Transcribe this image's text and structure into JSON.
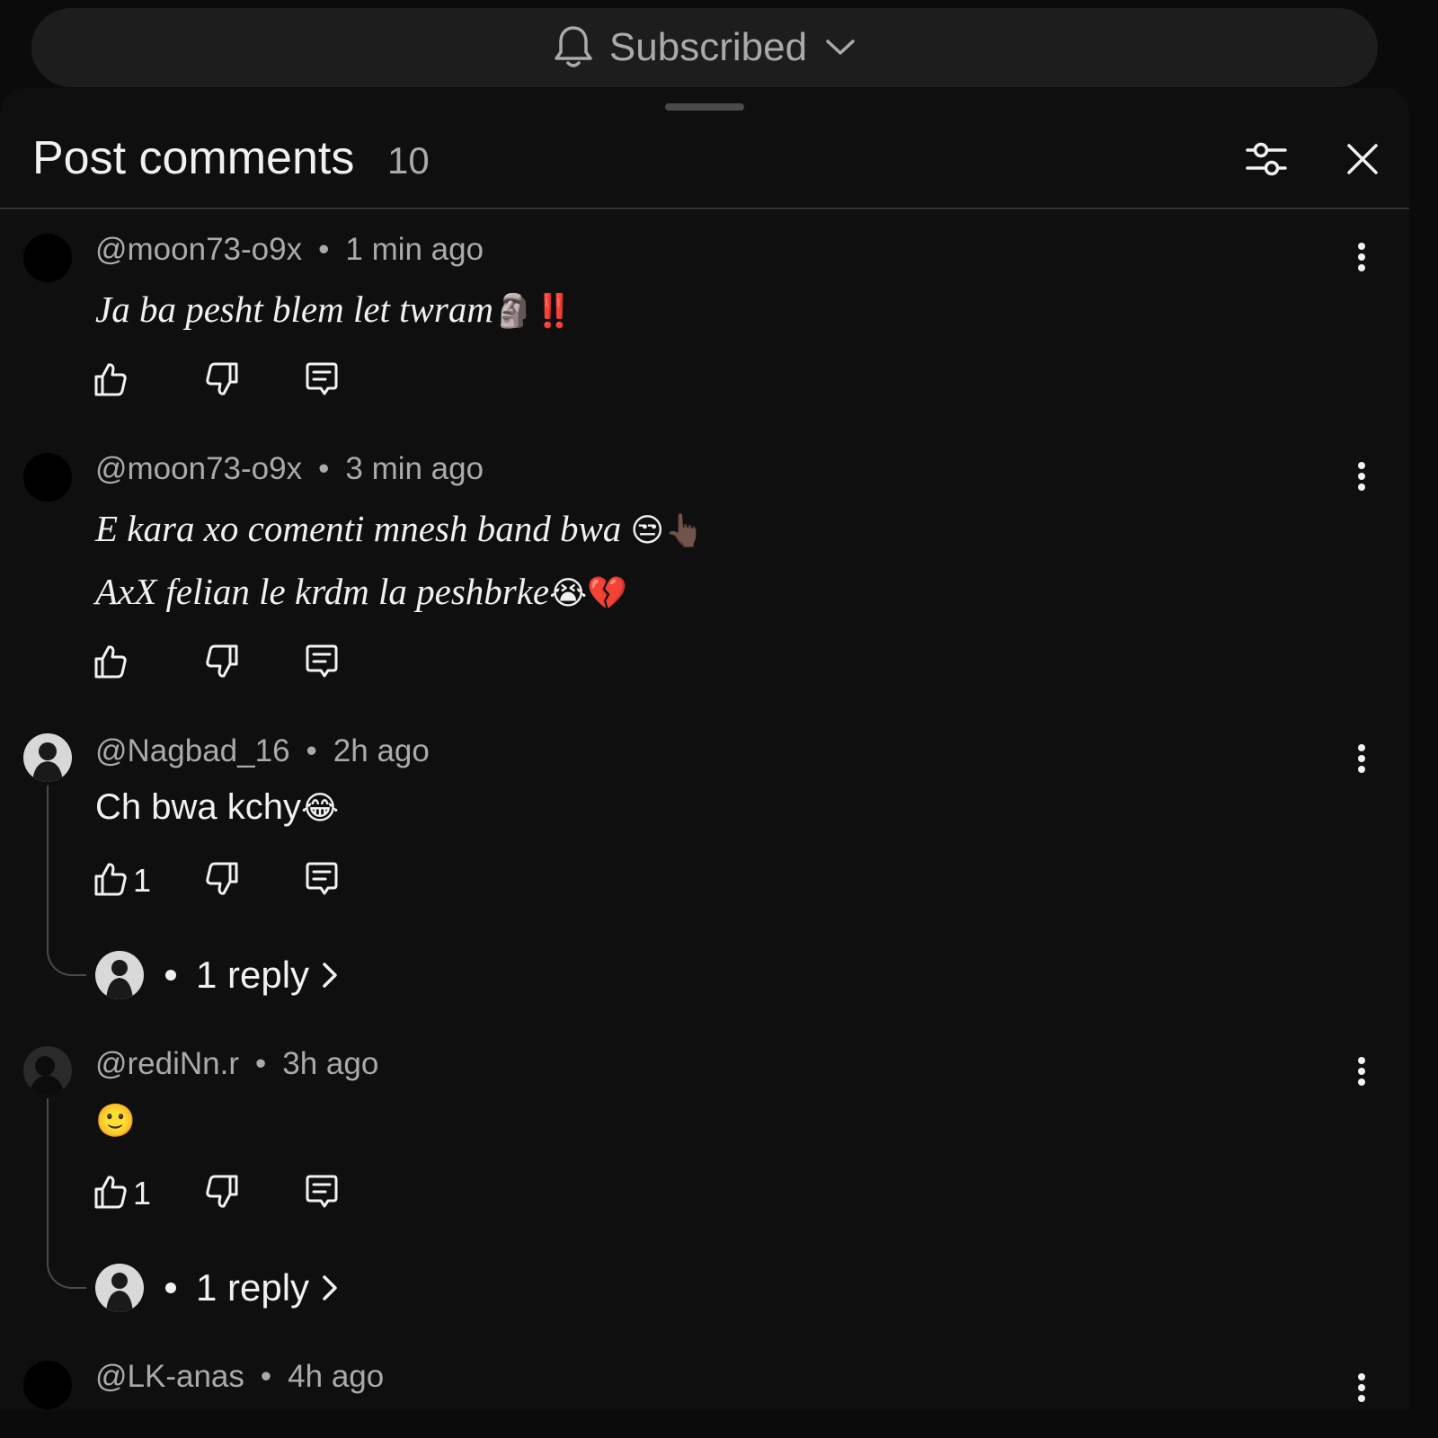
{
  "subscribe": {
    "label": "Subscribed",
    "icon": "bell-icon"
  },
  "header": {
    "title": "Post comments",
    "count": "10"
  },
  "comments": [
    {
      "author": "@moon73-o9x",
      "time": "1 min ago",
      "lines": [
        "Ja ba pesht blem let twram",
        "🗿‼️"
      ]
    },
    {
      "author": "@moon73-o9x",
      "time": "3 min ago",
      "lines": [
        "E kara xo comenti mnesh band bwa ",
        "😒👆🏿",
        "AxX felian le krdm la peshbrke",
        "😭💔"
      ]
    },
    {
      "author": "@Nagbad_16",
      "time": "2h ago",
      "lines": [
        "Ch bwa kchy",
        "😂"
      ],
      "likes": "1",
      "replies": "1 reply"
    },
    {
      "author": "@rediNn.r",
      "time": "3h ago",
      "lines": [
        "🙂"
      ],
      "likes": "1",
      "replies": "1 reply"
    },
    {
      "author": "@LK-anas",
      "time": "4h ago"
    }
  ]
}
